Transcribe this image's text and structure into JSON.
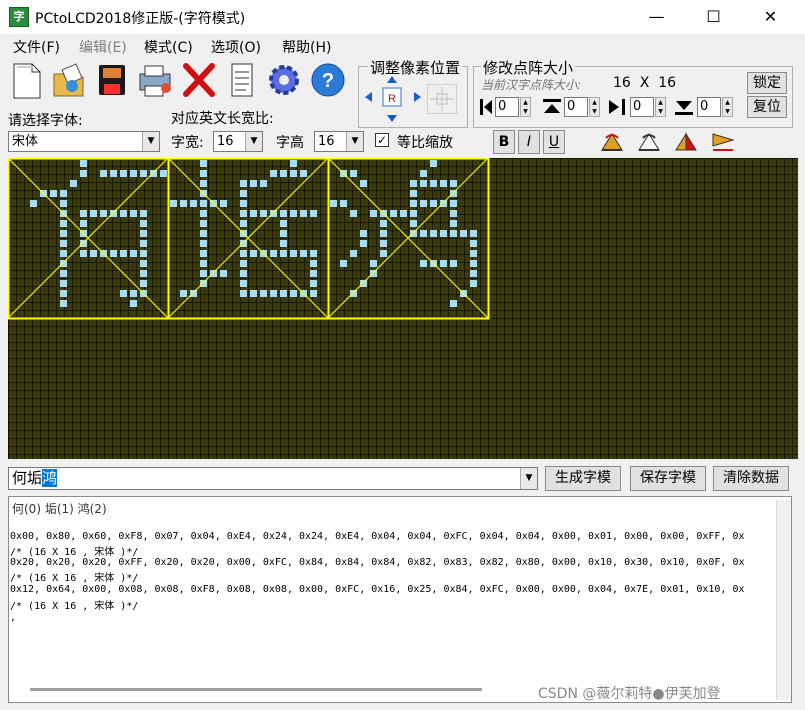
{
  "window": {
    "title": "PCtoLCD2018修正版-(字符模式)",
    "minimize": "—",
    "maximize": "☐",
    "close": "✕"
  },
  "menus": [
    {
      "label": "文件(F)",
      "enabled": true
    },
    {
      "label": "编辑(E)",
      "enabled": false
    },
    {
      "label": "模式(C)",
      "enabled": true
    },
    {
      "label": "选项(O)",
      "enabled": true
    },
    {
      "label": "帮助(H)",
      "enabled": true
    }
  ],
  "toolbar_icons": [
    "new-document-icon",
    "open-folder-icon",
    "save-icon",
    "print-icon",
    "delete-icon",
    "notepad-icon",
    "settings-gear-icon",
    "help-icon"
  ],
  "font_section": {
    "label": "请选择字体:",
    "font_value": "宋体"
  },
  "ratio_section": {
    "label": "对应英文长宽比:",
    "width_label": "字宽:",
    "width_value": "16",
    "height_label": "字高",
    "height_value": "16",
    "proportional_label": "等比缩放",
    "proportional_checked": true,
    "checkmark": "✓"
  },
  "pixel_adjust": {
    "title": "调整像素位置",
    "center": "R"
  },
  "matrix_size": {
    "title": "修改点阵大小",
    "current_label": "当前汉字点阵大小:",
    "current_value": "16  X  16",
    "lock_label": "锁定",
    "reset_label": "复位",
    "spin_values": [
      "0",
      "0",
      "0",
      "0"
    ]
  },
  "style_buttons": {
    "bold": "B",
    "italic": "I",
    "underline": "U"
  },
  "input": {
    "text_normal": "何垢",
    "text_selected": "鸿"
  },
  "actions": {
    "generate": "生成字模",
    "save": "保存字模",
    "clear": "清除数据"
  },
  "output": {
    "header": "何(0) 垢(1) 鸿(2)",
    "lines": [
      "0x00, 0x80, 0x60, 0xF8, 0x07, 0x04, 0xE4, 0x24, 0x24, 0xE4, 0x04, 0x04, 0xFC, 0x04, 0x04, 0x00, 0x01, 0x00, 0x00, 0xFF, 0x",
      "/* (16 X 16 , 宋体 )*/",
      "0x20, 0x20, 0x20, 0xFF, 0x20, 0x20, 0x00, 0xFC, 0x84, 0x84, 0x84, 0x82, 0x83, 0x82, 0x80, 0x00, 0x10, 0x30, 0x10, 0x0F, 0x",
      "/* (16 X 16 , 宋体 )*/",
      "0x12, 0x64, 0x00, 0x08, 0x08, 0xF8, 0x08, 0x08, 0x00, 0xFC, 0x16, 0x25, 0x84, 0xFC, 0x00, 0x00, 0x04, 0x7E, 0x01, 0x10, 0x",
      "/* (16 X 16 , 宋体 )*/",
      ","
    ]
  },
  "watermark": "CSDN @薇尔莉特●伊芙加登",
  "colors": {
    "grid_bg": "#3a3a0e",
    "pixel_on": "#a8dcf0",
    "frame": "#ffff00"
  }
}
